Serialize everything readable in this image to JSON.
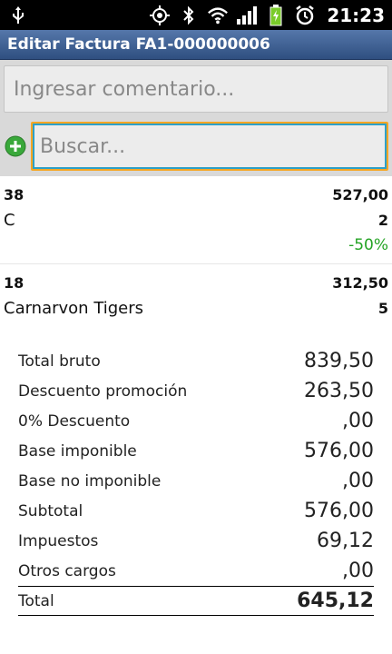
{
  "status_bar": {
    "icons": [
      "usb-icon",
      "gps-icon",
      "bluetooth-icon",
      "wifi-icon",
      "signal-icon",
      "battery-icon",
      "alarm-icon"
    ],
    "time": "21:23"
  },
  "title": "Editar Factura FA1-000000006",
  "comment_placeholder": "Ingresar comentario...",
  "search_placeholder": "Buscar...",
  "items": [
    {
      "code": "38",
      "amount": "527,00",
      "name": "C",
      "qty": "2",
      "discount": "-50%"
    },
    {
      "code": "18",
      "amount": "312,50",
      "name": "Carnarvon Tigers",
      "qty": "5"
    }
  ],
  "totals": [
    {
      "label": "Total bruto",
      "value": "839,50"
    },
    {
      "label": "Descuento promoción",
      "value": "263,50"
    },
    {
      "label": "0% Descuento",
      "value": ",00"
    },
    {
      "label": "Base imponible",
      "value": "576,00"
    },
    {
      "label": "Base no imponible",
      "value": ",00"
    },
    {
      "label": "Subtotal",
      "value": "576,00"
    },
    {
      "label": "Impuestos",
      "value": "69,12"
    },
    {
      "label": "Otros cargos",
      "value": ",00"
    },
    {
      "label": "Total",
      "value": "645,12"
    }
  ],
  "colors": {
    "accent": "#2f4f80",
    "discount": "#24a324",
    "focus": "#f5a623"
  }
}
